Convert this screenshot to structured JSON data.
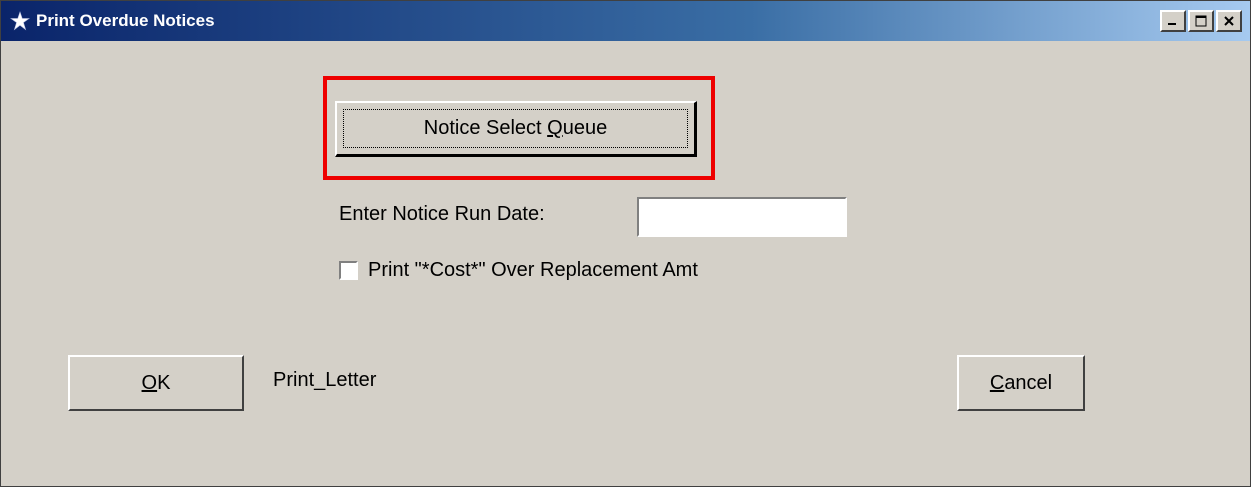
{
  "window": {
    "title": "Print Overdue Notices",
    "icon": "star-app-icon",
    "controls": [
      "minimize-icon",
      "maximize-icon",
      "close-icon"
    ]
  },
  "queue_button": {
    "label_pre": "Notice Select ",
    "label_accel": "Q",
    "label_post": "ueue"
  },
  "run_date": {
    "label": "Enter Notice Run Date:",
    "value": ""
  },
  "cost_checkbox": {
    "label": "Print \"*Cost*\" Over Replacement Amt",
    "checked": false
  },
  "ok_button": {
    "label_accel": "O",
    "label_post": "K"
  },
  "cancel_button": {
    "label_accel": "C",
    "label_post": "ancel"
  },
  "status_text": "Print_Letter",
  "colors": {
    "highlight": "#ee0000",
    "window_bg": "#d4d0c8",
    "titlebar_start": "#0a246a",
    "titlebar_end": "#a6caf0"
  }
}
